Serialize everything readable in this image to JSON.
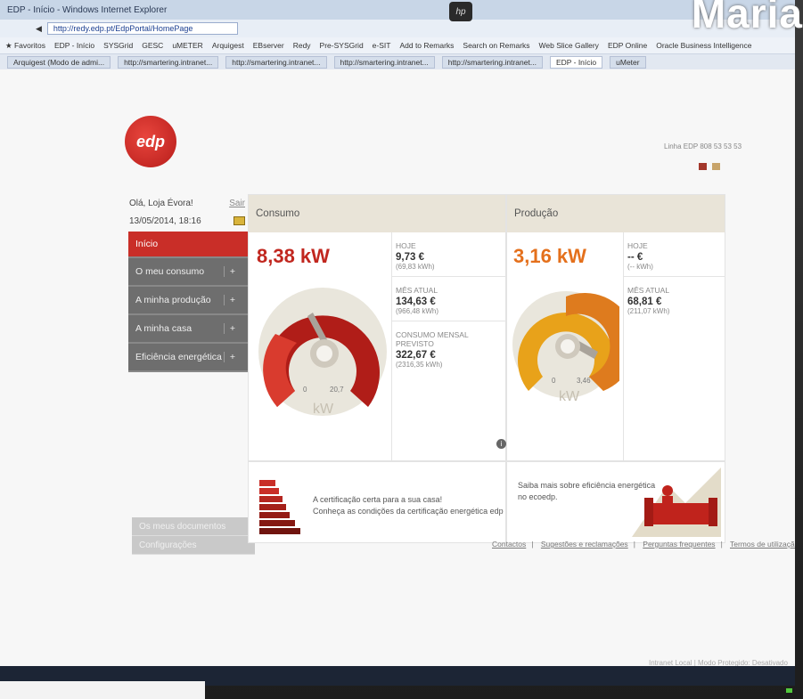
{
  "window": {
    "title": "EDP - Início - Windows Internet Explorer"
  },
  "browser": {
    "url": "http://redy.edp.pt/EdpPortal/HomePage",
    "favorites_label": "Favoritos",
    "favorites": [
      "EDP - Início",
      "SYSGrid",
      "GESC",
      "uMETER",
      "Arquigest",
      "EBserver",
      "Redy",
      "Pre-SYSGrid",
      "e-SIT",
      "Add to Remarks",
      "Search on Remarks",
      "Web Slice Gallery",
      "EDP Online",
      "Oracle Business Intelligence"
    ],
    "tabs": [
      "Arquigest (Modo de admi...",
      "http://smartering.intranet...",
      "http://smartering.intranet...",
      "http://smartering.intranet...",
      "http://smartering.intranet...",
      "EDP - Início",
      "uMeter"
    ],
    "active_tab_index": 5
  },
  "overlay_text": "Maria",
  "header": {
    "logo_text": "edp",
    "phone": "Linha EDP 808 53 53 53"
  },
  "user": {
    "greeting": "Olá, Loja Évora!",
    "logout": "Sair",
    "datetime": "13/05/2014, 18:16"
  },
  "menu": [
    {
      "label": "Início",
      "active": true,
      "expandable": false
    },
    {
      "label": "O meu consumo",
      "active": false,
      "expandable": true
    },
    {
      "label": "A minha produção",
      "active": false,
      "expandable": true
    },
    {
      "label": "A minha casa",
      "active": false,
      "expandable": true
    },
    {
      "label": "Eficiência energética",
      "active": false,
      "expandable": true
    }
  ],
  "menu_plus": "+",
  "secondary_menu": [
    "Os meus documentos",
    "Configurações"
  ],
  "consumo": {
    "title": "Consumo",
    "current": "8,38 kW",
    "current_kw": 8.38,
    "gauge_max_kw": 20.7,
    "gauge_min": "0",
    "gauge_max": "20,7",
    "unit": "kW",
    "stats": [
      {
        "label": "HOJE",
        "value": "9,73 €",
        "sub": "(69,83 kWh)"
      },
      {
        "label": "MÊS ATUAL",
        "value": "134,63 €",
        "sub": "(966,48 kWh)"
      },
      {
        "label": "CONSUMO MENSAL PREVISTO",
        "value": "322,67 €",
        "sub": "(2316,35 kWh)"
      }
    ],
    "info": "i"
  },
  "producao": {
    "title": "Produção",
    "current": "3,16 kW",
    "current_kw": 3.16,
    "gauge_max_kw": 3.46,
    "gauge_min": "0",
    "gauge_max": "3,46",
    "unit": "kW",
    "stats": [
      {
        "label": "HOJE",
        "value": "-- €",
        "sub": "(-- kWh)"
      },
      {
        "label": "MÊS ATUAL",
        "value": "68,81 €",
        "sub": "(211,07 kWh)"
      }
    ]
  },
  "promo_left": {
    "line1": "A certificação certa para a sua casa!",
    "line2": "Conheça as condições da certificação energética edp"
  },
  "promo_right": {
    "line1": "Saiba mais sobre eficiência energética",
    "line2": "no ecoedp."
  },
  "footer": [
    "Contactos",
    "Sugestões e reclamações",
    "Perguntas frequentes",
    "Termos de utilização"
  ],
  "statusbar": "Intranet Local | Modo Protegido: Desativado",
  "colors": {
    "edp_red": "#c92e28",
    "consumo_accent": "#c1271f",
    "producao_accent": "#e4701c",
    "panel_head": "#e9e4d8"
  }
}
